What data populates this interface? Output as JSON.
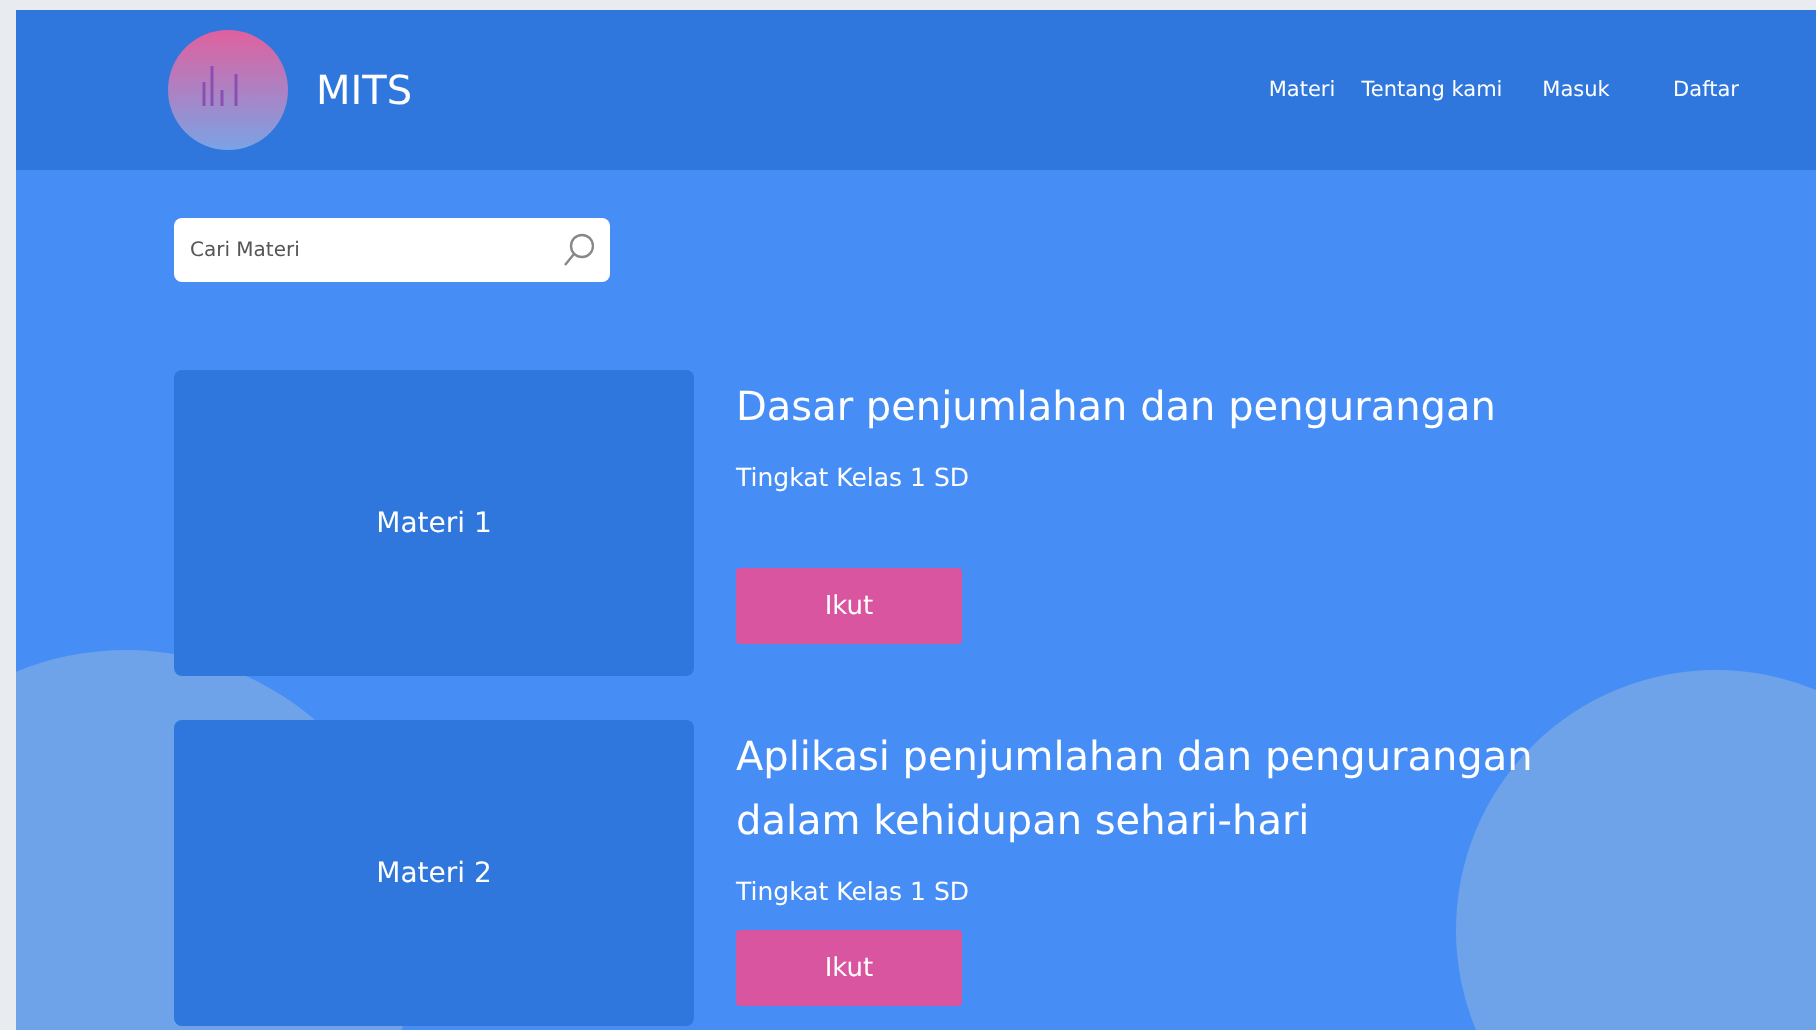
{
  "brand": {
    "name": "MITS"
  },
  "nav": [
    {
      "label": "Materi"
    },
    {
      "label": "Tentang kami"
    },
    {
      "label": "Masuk"
    },
    {
      "label": "Daftar"
    }
  ],
  "search": {
    "placeholder": "Cari Materi"
  },
  "courses": [
    {
      "thumbnail": "Materi 1",
      "title": "Dasar penjumlahan dan pengurangan",
      "level": "Tingkat Kelas 1 SD",
      "button": "Ikut"
    },
    {
      "thumbnail": "Materi 2",
      "title": "Aplikasi penjumlahan dan pengurangan dalam kehidupan sehari-hari",
      "level": "Tingkat Kelas 1 SD",
      "button": "Ikut"
    }
  ]
}
